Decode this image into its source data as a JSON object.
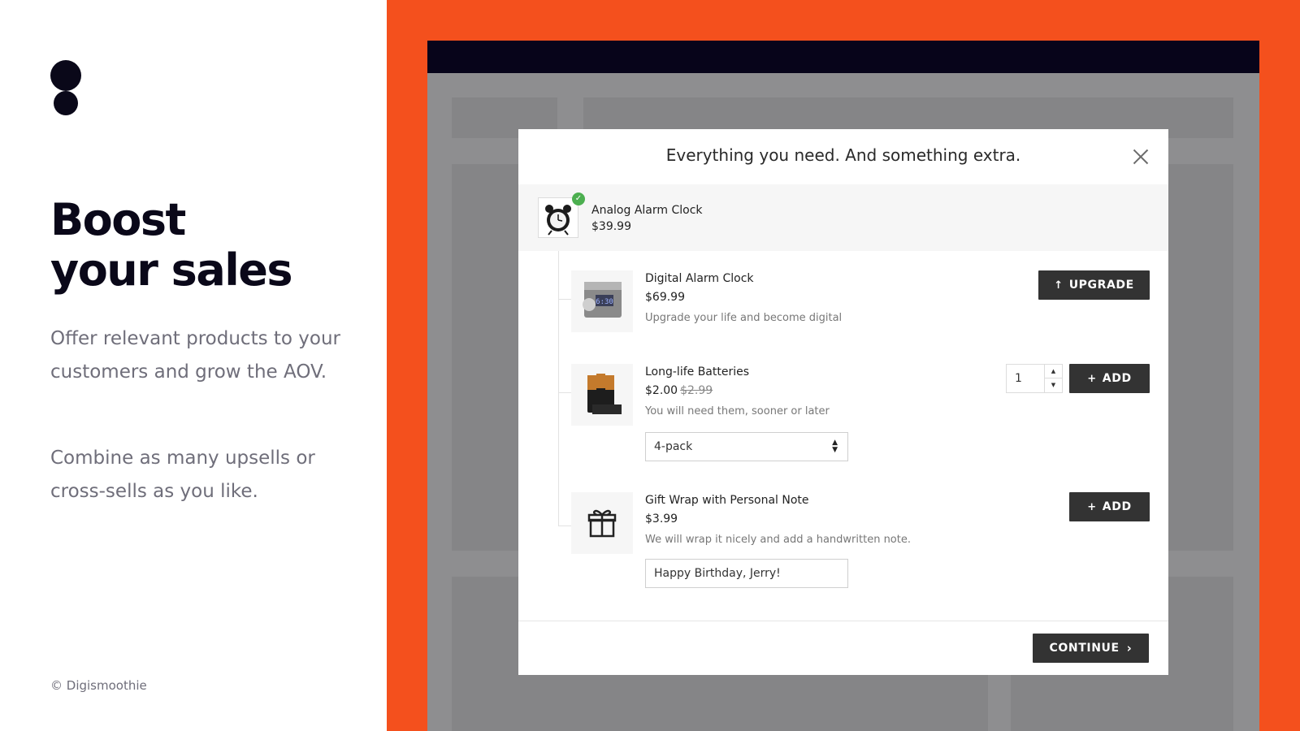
{
  "left": {
    "headline_line1": "Boost",
    "headline_line2": "your sales",
    "paragraph1": "Offer relevant products to your customers and grow the AOV.",
    "paragraph2": "Combine as many upsells or cross-sells as you like.",
    "copyright": "© Digismoothie"
  },
  "colors": {
    "accent": "#f4501d",
    "dark": "#0a0819",
    "button": "#333333",
    "check": "#4caf50"
  },
  "modal": {
    "title": "Everything you need. And something extra.",
    "main_product": {
      "name": "Analog Alarm Clock",
      "price": "$39.99",
      "icon": "alarm-clock-image",
      "status_icon": "check-icon"
    },
    "items": [
      {
        "name": "Digital Alarm Clock",
        "price": "$69.99",
        "description": "Upgrade your life and become digital",
        "button_label": "UPGRADE",
        "button_icon": "arrow-up-icon"
      },
      {
        "name": "Long-life Batteries",
        "price": "$2.00",
        "old_price": "$2.99",
        "description": "You will need them, sooner or later",
        "quantity": "1",
        "variant": "4-pack",
        "button_label": "ADD",
        "button_icon": "plus-icon"
      },
      {
        "name": "Gift Wrap with Personal Note",
        "price": "$3.99",
        "description": "We will wrap it nicely and add a handwritten note.",
        "note_value": "Happy Birthday, Jerry!",
        "button_label": "ADD",
        "button_icon": "plus-icon"
      }
    ],
    "continue_label": "CONTINUE"
  }
}
